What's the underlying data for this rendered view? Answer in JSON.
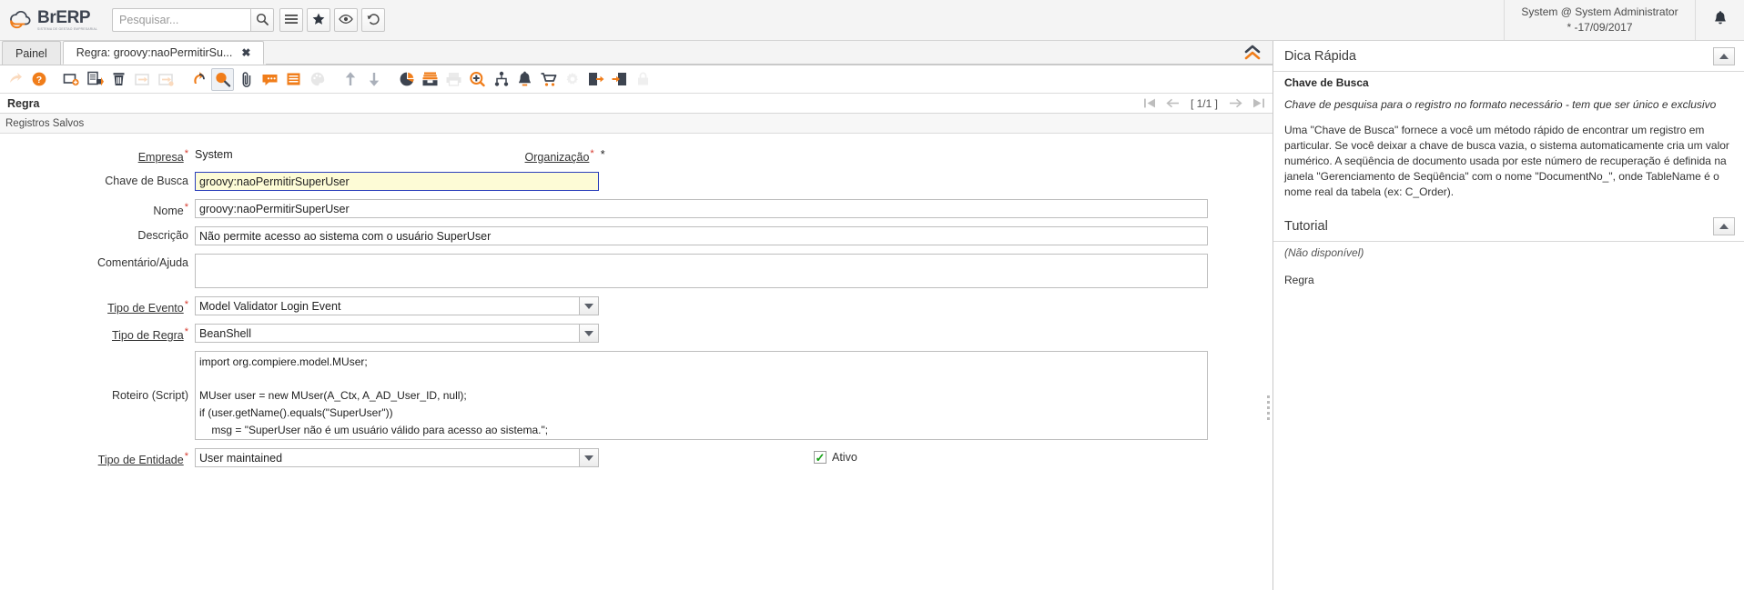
{
  "header": {
    "logo_name": "BrERP",
    "logo_sub": "SISTEMA DE GESTAO EMPRESARIAL",
    "logo_icon": "cloud-swirl-icon",
    "search_placeholder": "Pesquisar...",
    "search_value": "",
    "search_icon": "magnifier-icon",
    "menu_icon": "hamburger-menu-icon",
    "favorite_icon": "star-icon",
    "view_icon": "eye-icon",
    "history_icon": "history-undo-icon",
    "user_line1": "System @ System Administrator",
    "user_line2": "* -17/09/2017",
    "bell_icon": "bell-icon"
  },
  "tabs": {
    "items": [
      {
        "label": "Painel",
        "active": false,
        "closable": false
      },
      {
        "label": "Regra: groovy:naoPermitirSu...",
        "active": true,
        "closable": true
      }
    ],
    "close_glyph": "✖",
    "collapse_icon": "double-chevron-up-icon"
  },
  "toolbar": {
    "buttons": [
      {
        "name": "ignore-changes-icon",
        "glyph": "ignore",
        "state": "dim"
      },
      {
        "name": "help-icon",
        "glyph": "help",
        "state": "normal"
      },
      {
        "name": "new-record-icon",
        "glyph": "new",
        "state": "normal"
      },
      {
        "name": "copy-record-icon",
        "glyph": "copy",
        "state": "normal"
      },
      {
        "name": "delete-record-icon",
        "glyph": "trash",
        "state": "normal"
      },
      {
        "name": "export-icon",
        "glyph": "arrowbox",
        "state": "dim"
      },
      {
        "name": "import-icon",
        "glyph": "arrowbox2",
        "state": "dim"
      },
      {
        "name": "refresh-icon",
        "glyph": "refresh",
        "state": "normal"
      },
      {
        "name": "find-icon",
        "glyph": "find",
        "state": "selected"
      },
      {
        "name": "attachment-icon",
        "glyph": "clip",
        "state": "normal"
      },
      {
        "name": "chat-icon",
        "glyph": "chat",
        "state": "normal"
      },
      {
        "name": "post-it-icon",
        "glyph": "note",
        "state": "normal"
      },
      {
        "name": "archive-icon",
        "glyph": "palette",
        "state": "dim"
      },
      {
        "name": "parent-record-icon",
        "glyph": "arrowup",
        "state": "normal"
      },
      {
        "name": "detail-record-icon",
        "glyph": "arrowdown",
        "state": "normal"
      },
      {
        "name": "report-icon",
        "glyph": "piechart",
        "state": "normal"
      },
      {
        "name": "print-preview-icon",
        "glyph": "printdoc",
        "state": "normal"
      },
      {
        "name": "print-icon",
        "glyph": "printer",
        "state": "dim"
      },
      {
        "name": "zoom-across-icon",
        "glyph": "zoomplus",
        "state": "normal"
      },
      {
        "name": "workflow-icon",
        "glyph": "orgtree",
        "state": "normal"
      },
      {
        "name": "request-icon",
        "glyph": "bell",
        "state": "normal"
      },
      {
        "name": "product-info-icon",
        "glyph": "cart",
        "state": "normal"
      },
      {
        "name": "preference-icon",
        "glyph": "gear",
        "state": "dim"
      },
      {
        "name": "exit-window-icon",
        "glyph": "exit",
        "state": "normal"
      },
      {
        "name": "exit-window-alt-icon",
        "glyph": "exit2",
        "state": "normal"
      },
      {
        "name": "lock-icon",
        "glyph": "lock",
        "state": "dim"
      }
    ]
  },
  "record": {
    "title": "Regra",
    "pager_text": "[ 1/1 ]",
    "first_icon": "first-record-icon",
    "prev_icon": "previous-record-icon",
    "next_icon": "next-record-icon",
    "last_icon": "last-record-icon",
    "saved_label": "Registros Salvos"
  },
  "form": {
    "empresa_label": "Empresa",
    "empresa_value": "System",
    "organizacao_label": "Organização",
    "organizacao_value": "*",
    "chave_label": "Chave de Busca",
    "chave_value": "groovy:naoPermitirSuperUser",
    "nome_label": "Nome",
    "nome_value": "groovy:naoPermitirSuperUser",
    "descricao_label": "Descrição",
    "descricao_value": "Não permite acesso ao sistema com o usuário SuperUser",
    "comentario_label": "Comentário/Ajuda",
    "comentario_value": "",
    "tipo_evento_label": "Tipo de Evento",
    "tipo_evento_value": "Model Validator Login Event",
    "tipo_regra_label": "Tipo de Regra",
    "tipo_regra_value": "BeanShell",
    "roteiro_label": "Roteiro (Script)",
    "roteiro_value": "import org.compiere.model.MUser;\n\nMUser user = new MUser(A_Ctx, A_AD_User_ID, null);\nif (user.getName().equals(\"SuperUser\"))\n    msg = \"SuperUser não é um usuário válido para acesso ao sistema.\";\nelse\n    msg = \"\";\n",
    "tipo_entidade_label": "Tipo de Entidade",
    "tipo_entidade_value": "User maintained",
    "ativo_label": "Ativo",
    "ativo_checked": true,
    "dropdown_icon": "chevron-down-icon"
  },
  "right_panel": {
    "quick_tip": {
      "title": "Dica Rápida",
      "toggle_icon": "chevron-up-icon",
      "field_name": "Chave de Busca",
      "description": "Chave de pesquisa para o registro no formato necessário - tem que ser único e exclusivo",
      "help": "Uma \"Chave de Busca\" fornece a você um método rápido de encontrar um registro em particular. Se você deixar a chave de busca vazia, o sistema automaticamente cria um valor numérico. A seqüência de documento usada por este número de recuperação é definida na janela \"Gerenciamento de Seqüência\" com o nome \"DocumentNo_\", onde TableName é o nome real da tabela (ex: C_Order)."
    },
    "tutorial": {
      "title": "Tutorial",
      "toggle_icon": "chevron-up-icon",
      "content": "(Não disponível)",
      "footer": "Regra"
    }
  },
  "colors": {
    "accent": "#f07d1a",
    "dark": "#3d4450",
    "focus_border": "#2b3fbb",
    "focus_bg": "#fdfbd6",
    "required": "#d63a2f",
    "check_green": "#15a015"
  }
}
